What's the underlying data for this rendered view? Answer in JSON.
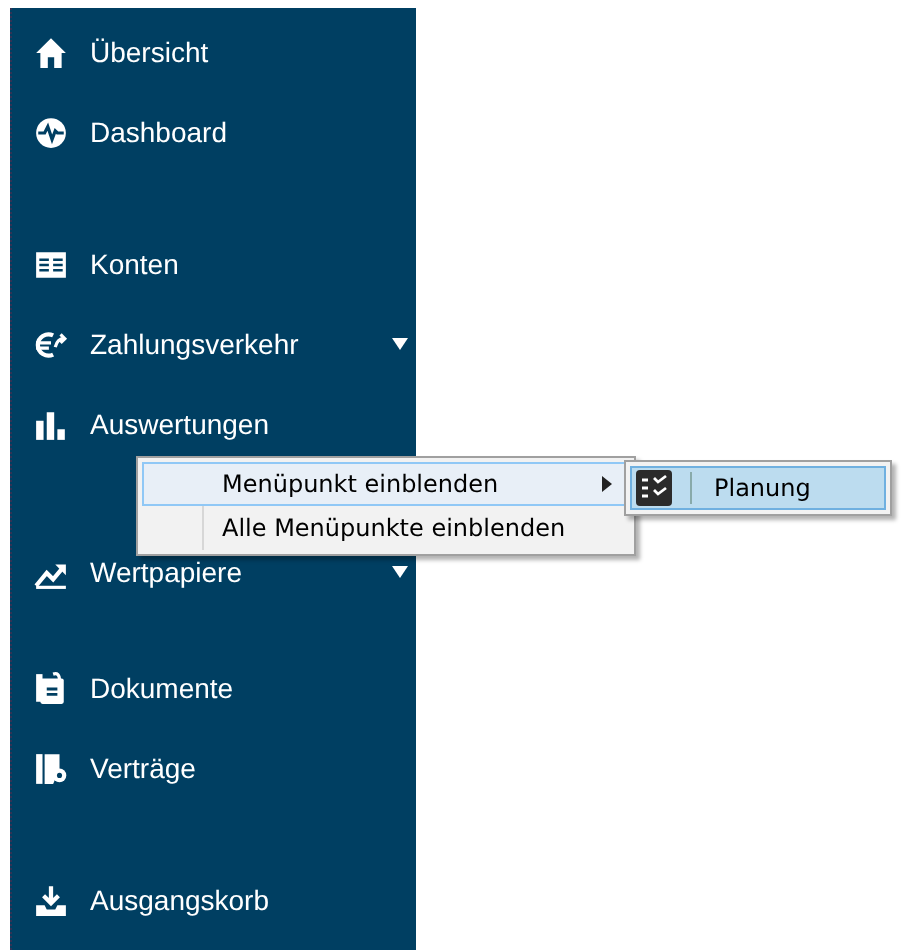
{
  "sidebar": {
    "groups": [
      {
        "items": [
          {
            "label": "Übersicht",
            "has_submenu": false
          },
          {
            "label": "Dashboard",
            "has_submenu": false
          }
        ]
      },
      {
        "items": [
          {
            "label": "Konten",
            "has_submenu": false
          },
          {
            "label": "Zahlungsverkehr",
            "has_submenu": true
          },
          {
            "label": "Auswertungen",
            "has_submenu": false
          }
        ]
      },
      {
        "items": [
          {
            "label": "Wertpapiere",
            "has_submenu": true
          }
        ]
      },
      {
        "items": [
          {
            "label": "Dokumente",
            "has_submenu": false
          },
          {
            "label": "Verträge",
            "has_submenu": false
          }
        ]
      },
      {
        "items": [
          {
            "label": "Ausgangskorb",
            "has_submenu": false
          }
        ]
      }
    ]
  },
  "context_menu": {
    "items": [
      {
        "label": "Menüpunkt einblenden",
        "has_submenu": true,
        "selected": true
      },
      {
        "label": "Alle Menüpunkte einblenden",
        "has_submenu": false,
        "selected": false
      }
    ],
    "submenu": {
      "items": [
        {
          "label": "Planung",
          "selected": true
        }
      ]
    }
  }
}
